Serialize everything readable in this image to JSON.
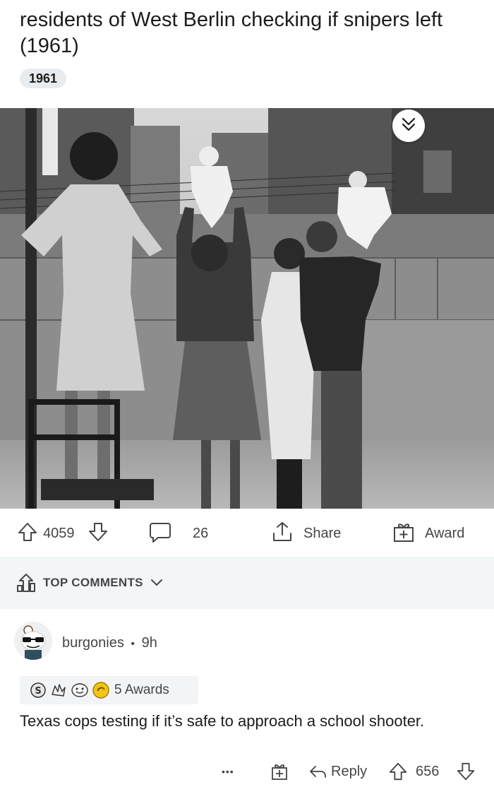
{
  "post": {
    "title": "residents of West Berlin checking if snipers left (1961)",
    "flair": "1961"
  },
  "actions": {
    "upvotes": "4059",
    "comments": "26",
    "share_label": "Share",
    "award_label": "Award"
  },
  "comments_header": {
    "label": "TOP COMMENTS"
  },
  "comment": {
    "author": "burgonies",
    "separator": "•",
    "age": "9h",
    "awards_label": "5 Awards",
    "body": "Texas cops testing if it’s safe to approach a school shooter.",
    "more_label": "•••",
    "reply_label": "Reply",
    "score": "656"
  },
  "icons": [
    "upvote-icon",
    "downvote-icon",
    "comment-icon",
    "share-icon",
    "award-icon",
    "top-comments-icon",
    "chevron-down-icon",
    "collapse-icon",
    "more-icon",
    "reply-icon"
  ]
}
